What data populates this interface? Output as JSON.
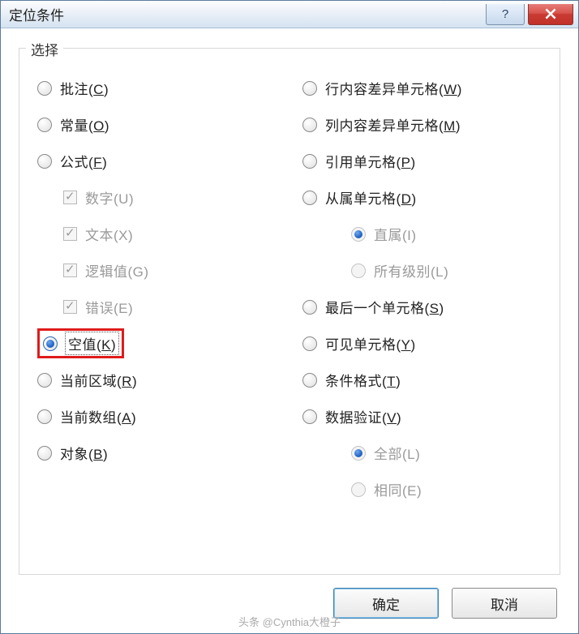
{
  "title": "定位条件",
  "group_title": "选择",
  "left": [
    {
      "type": "radio",
      "label": "批注",
      "accel": "C",
      "selected": false
    },
    {
      "type": "radio",
      "label": "常量",
      "accel": "O",
      "selected": false
    },
    {
      "type": "radio",
      "label": "公式",
      "accel": "F",
      "selected": false
    },
    {
      "type": "checkbox",
      "label": "数字(U)",
      "checked": true,
      "indent": 1,
      "disabled": true
    },
    {
      "type": "checkbox",
      "label": "文本(X)",
      "checked": true,
      "indent": 1,
      "disabled": true
    },
    {
      "type": "checkbox",
      "label": "逻辑值(G)",
      "checked": true,
      "indent": 1,
      "disabled": true
    },
    {
      "type": "checkbox",
      "label": "错误(E)",
      "checked": true,
      "indent": 1,
      "disabled": true
    },
    {
      "type": "radio",
      "label": "空值",
      "accel": "K",
      "selected": true,
      "highlight": true,
      "focus": true
    },
    {
      "type": "radio",
      "label": "当前区域",
      "accel": "R",
      "selected": false
    },
    {
      "type": "radio",
      "label": "当前数组",
      "accel": "A",
      "selected": false
    },
    {
      "type": "radio",
      "label": "对象",
      "accel": "B",
      "selected": false
    }
  ],
  "right": [
    {
      "type": "radio",
      "label": "行内容差异单元格",
      "accel": "W",
      "selected": false
    },
    {
      "type": "radio",
      "label": "列内容差异单元格",
      "accel": "M",
      "selected": false
    },
    {
      "type": "radio",
      "label": "引用单元格",
      "accel": "P",
      "selected": false
    },
    {
      "type": "radio",
      "label": "从属单元格",
      "accel": "D",
      "selected": false
    },
    {
      "type": "radio",
      "label": "直属(I)",
      "selected": true,
      "indent": 2,
      "disabled": true
    },
    {
      "type": "radio",
      "label": "所有级别(L)",
      "selected": false,
      "indent": 2,
      "disabled": true
    },
    {
      "type": "radio",
      "label": "最后一个单元格",
      "accel": "S",
      "selected": false
    },
    {
      "type": "radio",
      "label": "可见单元格",
      "accel": "Y",
      "selected": false
    },
    {
      "type": "radio",
      "label": "条件格式",
      "accel": "T",
      "selected": false
    },
    {
      "type": "radio",
      "label": "数据验证",
      "accel": "V",
      "selected": false
    },
    {
      "type": "radio",
      "label": "全部(L)",
      "selected": true,
      "indent": 2,
      "disabled": true
    },
    {
      "type": "radio",
      "label": "相同(E)",
      "selected": false,
      "indent": 2,
      "disabled": true
    }
  ],
  "buttons": {
    "ok": "确定",
    "cancel": "取消"
  },
  "watermark": "头条 @Cynthia大橙子"
}
